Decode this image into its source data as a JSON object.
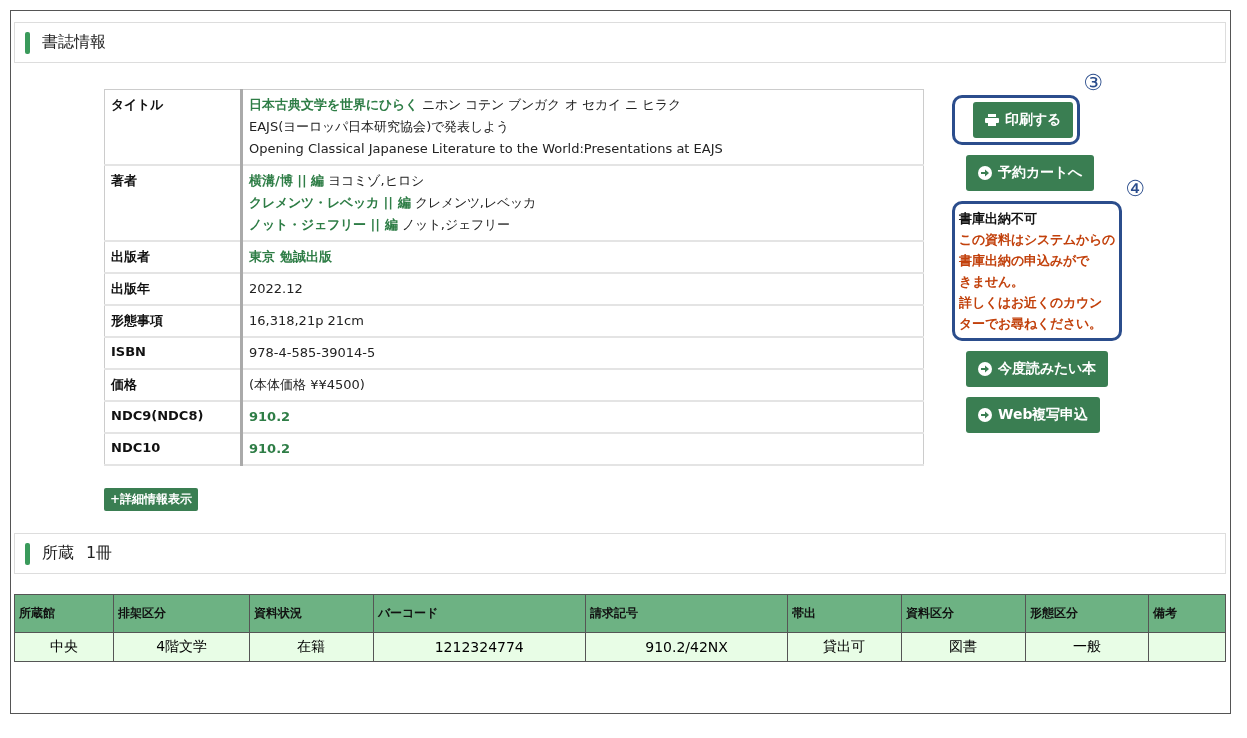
{
  "bib_section": {
    "title": "書誌情報"
  },
  "details": [
    {
      "label": "タイトル",
      "lines": [
        [
          {
            "text": "日本古典文学を世界にひらく",
            "link": true
          },
          {
            "text": " ニホン コテン ブンガク オ セカイ ニ ヒラク",
            "link": false
          }
        ],
        [
          {
            "text": "EAJS(ヨーロッパ日本研究協会)で発表しよう",
            "link": false
          }
        ],
        [
          {
            "text": "Opening Classical Japanese Literature to the World:Presentations at EAJS",
            "link": false
          }
        ]
      ]
    },
    {
      "label": "著者",
      "lines": [
        [
          {
            "text": "横溝/博 || 編",
            "link": true
          },
          {
            "text": " ヨコミゾ,ヒロシ",
            "link": false
          }
        ],
        [
          {
            "text": "クレメンツ・レベッカ || 編",
            "link": true
          },
          {
            "text": " クレメンツ,レベッカ",
            "link": false
          }
        ],
        [
          {
            "text": "ノット・ジェフリー || 編",
            "link": true
          },
          {
            "text": " ノット,ジェフリー",
            "link": false
          }
        ]
      ]
    },
    {
      "label": "出版者",
      "lines": [
        [
          {
            "text": "東京 勉誠出版",
            "link": true
          }
        ]
      ]
    },
    {
      "label": "出版年",
      "lines": [
        [
          {
            "text": "2022.12",
            "link": false
          }
        ]
      ]
    },
    {
      "label": "形態事項",
      "lines": [
        [
          {
            "text": "16,318,21p 21cm",
            "link": false
          }
        ]
      ]
    },
    {
      "label": "ISBN",
      "lines": [
        [
          {
            "text": "978-4-585-39014-5",
            "link": false
          }
        ]
      ]
    },
    {
      "label": "価格",
      "lines": [
        [
          {
            "text": "(本体価格 ¥¥4500)",
            "link": false
          }
        ]
      ]
    },
    {
      "label": "NDC9(NDC8)",
      "lines": [
        [
          {
            "text": "910.2",
            "link": true
          }
        ]
      ]
    },
    {
      "label": "NDC10",
      "lines": [
        [
          {
            "text": "910.2",
            "link": true
          }
        ]
      ]
    }
  ],
  "detail_toggle": "+詳細情報表示",
  "actions": [
    {
      "kind": "print",
      "label": "印刷する",
      "callout": "③"
    },
    {
      "kind": "button",
      "label": "予約カートへ"
    },
    {
      "kind": "notice",
      "title": "書庫出納不可",
      "message": [
        "この資料はシステムからの",
        "書庫出納の申込みがで",
        "きません。",
        "詳しくはお近くのカウン",
        "ターでお尋ねください。"
      ],
      "callout": "④"
    },
    {
      "kind": "button",
      "label": "今度読みたい本"
    },
    {
      "kind": "button",
      "label": "Web複写申込"
    }
  ],
  "holdings_section": {
    "title": "所蔵",
    "count": "1冊"
  },
  "holdings": {
    "columns": [
      "所蔵館",
      "排架区分",
      "資料状況",
      "バーコード",
      "請求記号",
      "帯出",
      "資料区分",
      "形態区分",
      "備考"
    ],
    "rows": [
      [
        "中央",
        "4階文学",
        "在籍",
        "1212324774",
        "910.2/42NX",
        "貸出可",
        "図書",
        "一般",
        ""
      ]
    ]
  }
}
